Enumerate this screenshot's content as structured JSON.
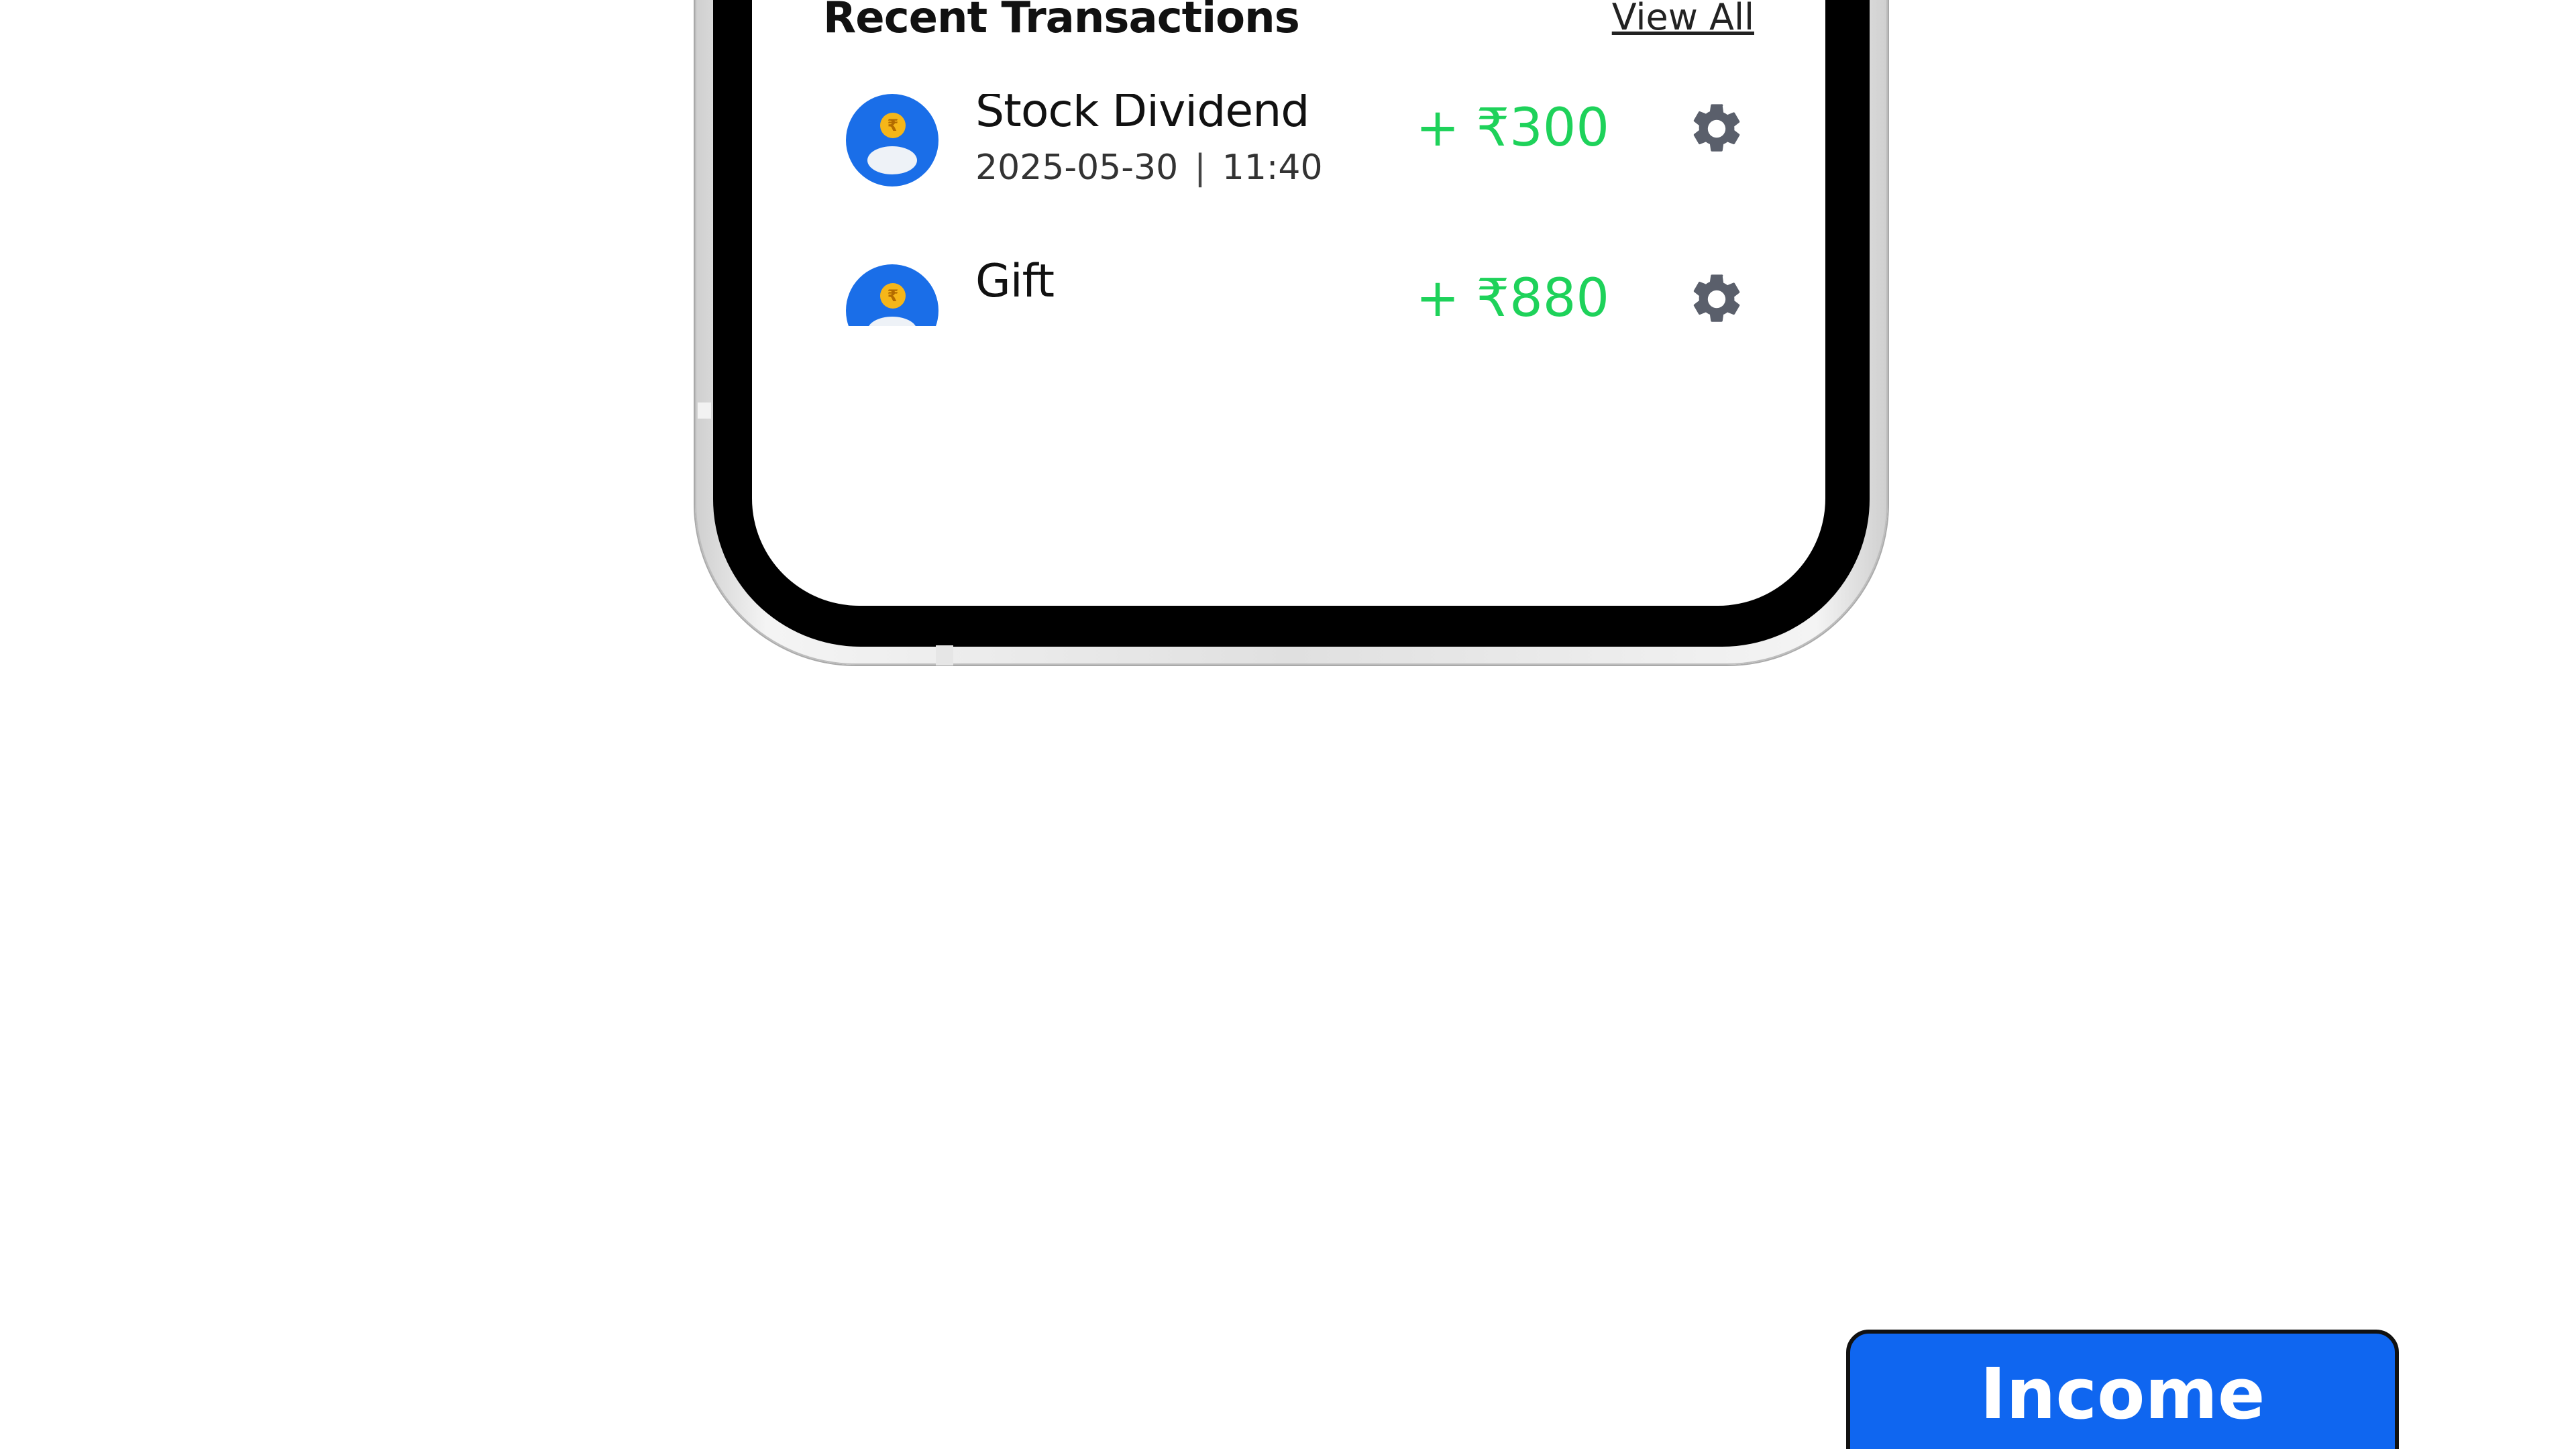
{
  "recent_transactions": {
    "title": "Recent Transactions",
    "view_all_label": "View All",
    "items": [
      {
        "name": "Stock Dividend",
        "date": "2025-05-30",
        "separator": "|",
        "time": "11:40",
        "amount": "+ ₹300",
        "icon": "rupee-coin-user-icon",
        "action_icon": "gear-icon"
      },
      {
        "name": "Gift",
        "date": "",
        "separator": "",
        "time": "",
        "amount": "+ ₹880",
        "icon": "rupee-coin-user-icon",
        "action_icon": "gear-icon"
      }
    ]
  },
  "income_button": {
    "label": "Income"
  },
  "colors": {
    "accent_blue": "#0f66f0",
    "amount_green": "#1ed25a",
    "gear_gray": "#5a5f6b"
  }
}
